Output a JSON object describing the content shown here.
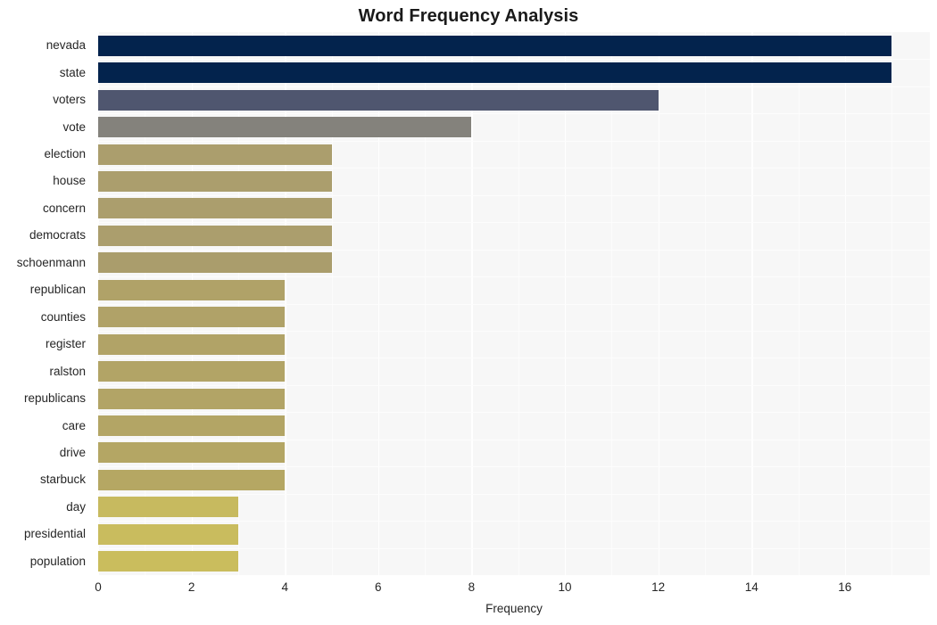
{
  "chart_data": {
    "type": "bar",
    "orientation": "horizontal",
    "title": "Word Frequency Analysis",
    "xlabel": "Frequency",
    "ylabel": "",
    "categories": [
      "nevada",
      "state",
      "voters",
      "vote",
      "election",
      "house",
      "concern",
      "democrats",
      "schoenmann",
      "republican",
      "counties",
      "register",
      "ralston",
      "republicans",
      "care",
      "drive",
      "starbuck",
      "day",
      "presidential",
      "population"
    ],
    "values": [
      17,
      17,
      12,
      8,
      5,
      5,
      5,
      5,
      5,
      4,
      4,
      4,
      4,
      4,
      4,
      4,
      4,
      3,
      3,
      3
    ],
    "bar_colors": [
      "#03234d",
      "#03234d",
      "#4f566f",
      "#84827c",
      "#ab9e6d",
      "#ab9e6d",
      "#ab9e6d",
      "#ab9e6d",
      "#aa9d6c",
      "#b0a268",
      "#b0a268",
      "#b1a367",
      "#b2a466",
      "#b2a466",
      "#b3a565",
      "#b4a664",
      "#b5a763",
      "#c7ba5f",
      "#c9bc5e",
      "#cabd5d"
    ],
    "xticks": [
      0,
      2,
      4,
      6,
      8,
      10,
      12,
      14,
      16
    ],
    "xlim": [
      0,
      17.82
    ],
    "grid": true,
    "grid_color": "#ffffff",
    "plot_background": "#f7f7f7",
    "figure_background": "#ffffff",
    "legend": null
  }
}
